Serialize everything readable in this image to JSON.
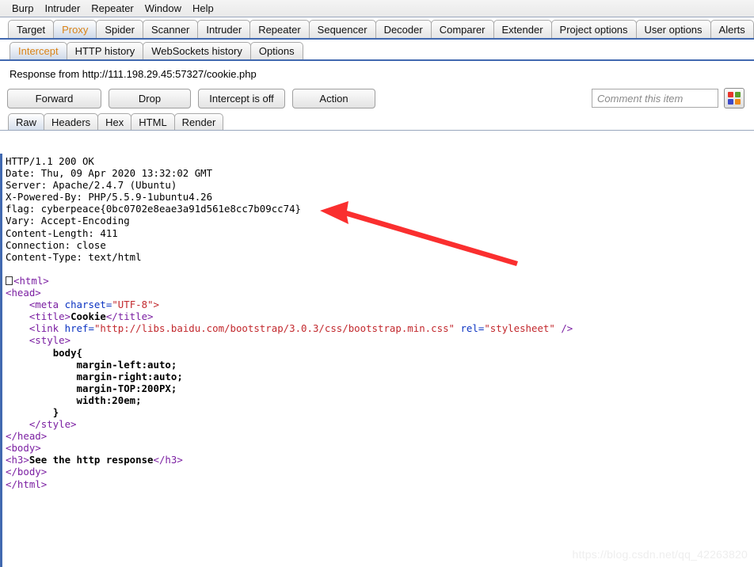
{
  "menubar": {
    "items": [
      {
        "label": "Burp"
      },
      {
        "label": "Intruder"
      },
      {
        "label": "Repeater"
      },
      {
        "label": "Window"
      },
      {
        "label": "Help"
      }
    ]
  },
  "main_tabs": {
    "active": "Proxy",
    "items": [
      {
        "label": "Target"
      },
      {
        "label": "Proxy"
      },
      {
        "label": "Spider"
      },
      {
        "label": "Scanner"
      },
      {
        "label": "Intruder"
      },
      {
        "label": "Repeater"
      },
      {
        "label": "Sequencer"
      },
      {
        "label": "Decoder"
      },
      {
        "label": "Comparer"
      },
      {
        "label": "Extender"
      },
      {
        "label": "Project options"
      },
      {
        "label": "User options"
      },
      {
        "label": "Alerts"
      }
    ]
  },
  "sub_tabs": {
    "active": "Intercept",
    "items": [
      {
        "label": "Intercept"
      },
      {
        "label": "HTTP history"
      },
      {
        "label": "WebSockets history"
      },
      {
        "label": "Options"
      }
    ]
  },
  "response_bar": {
    "text": "Response from http://111.198.29.45:57327/cookie.php"
  },
  "buttons": {
    "forward": "Forward",
    "drop": "Drop",
    "intercept_toggle": "Intercept is off",
    "action": "Action"
  },
  "comment": {
    "value": "",
    "placeholder": "Comment this item"
  },
  "color_button": {
    "name": "highlight-color-picker",
    "swatches": [
      "#e8342a",
      "#5aa02c",
      "#3d49c8",
      "#f08a17"
    ]
  },
  "view_tabs": {
    "active": "Raw",
    "items": [
      {
        "label": "Raw"
      },
      {
        "label": "Headers"
      },
      {
        "label": "Hex"
      },
      {
        "label": "HTML"
      },
      {
        "label": "Render"
      }
    ]
  },
  "response": {
    "headers": [
      "HTTP/1.1 200 OK",
      "Date: Thu, 09 Apr 2020 13:32:02 GMT",
      "Server: Apache/2.4.7 (Ubuntu)",
      "X-Powered-By: PHP/5.5.9-1ubuntu4.26",
      "flag: cyberpeace{0bc0702e8eae3a91d561e8cc7b09cc74}",
      "Vary: Accept-Encoding",
      "Content-Length: 411",
      "Connection: close",
      "Content-Type: text/html"
    ],
    "flag_value": "cyberpeace{0bc0702e8eae3a91d561e8cc7b09cc74}",
    "body_lines": {
      "html_open": "<html>",
      "head_open": "<head>",
      "meta_charset_tag": "<meta",
      "meta_charset_attr": "charset=",
      "meta_charset_value": "\"UTF-8\">",
      "title_open": "<title>",
      "title_text": "Cookie",
      "title_close": "</title>",
      "link_tag": "<link",
      "link_href_attr": "href=",
      "link_href_value": "\"http://libs.baidu.com/bootstrap/3.0.3/css/bootstrap.min.css\"",
      "link_rel_attr": "rel=",
      "link_rel_value": "\"stylesheet\"",
      "link_end": "/>",
      "style_open": "<style>",
      "css_body_open": "body{",
      "css_margin_left": "margin-left:auto;",
      "css_margin_right": "margin-right:auto;",
      "css_margin_top": "margin-TOP:200PX;",
      "css_width": "width:20em;",
      "css_body_close": "}",
      "style_close": "</style>",
      "head_close": "</head>",
      "body_open": "<body>",
      "h3_open": "<h3>",
      "h3_text": "See the http response",
      "h3_close": "</h3>",
      "body_close": "</body>",
      "html_close": "</html>"
    }
  },
  "annotation": {
    "arrow_color": "#fa2f2f",
    "points_to": "flag header line"
  },
  "watermark": {
    "text": "https://blog.csdn.net/qq_42263820"
  }
}
